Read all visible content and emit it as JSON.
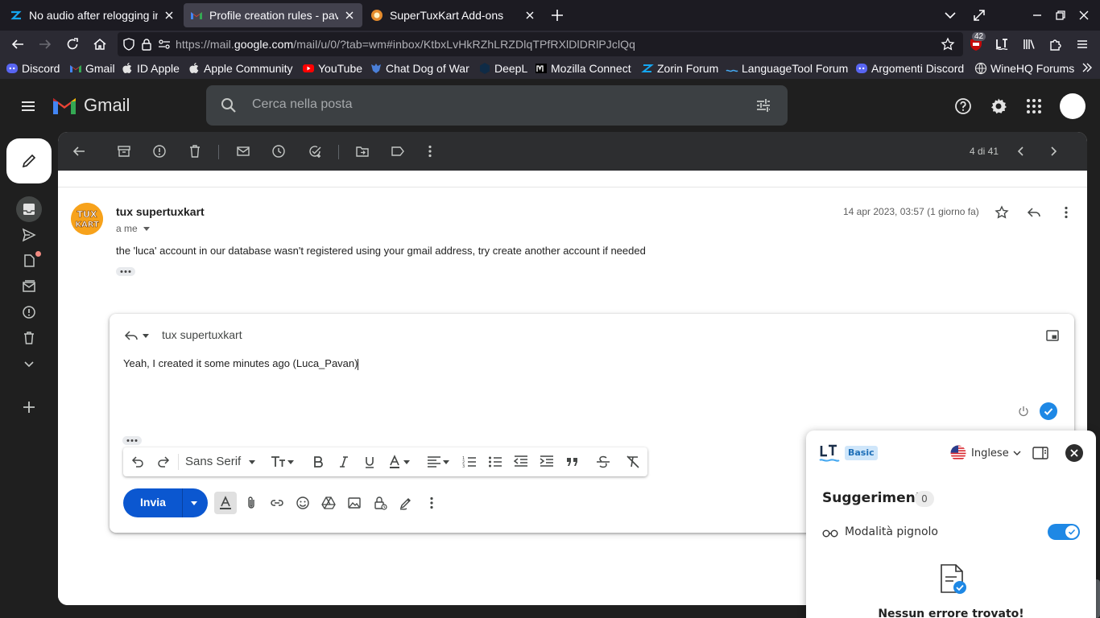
{
  "browser": {
    "tabs": [
      {
        "title": "No audio after relogging in",
        "active": false
      },
      {
        "title": "Profile creation rules - pav",
        "active": true
      },
      {
        "title": "SuperTuxKart Add-ons",
        "active": false
      }
    ],
    "url_prefix": "https://mail.",
    "url_domain": "google.com",
    "url_rest": "/mail/u/0/?tab=wm#inbox/KtbxLvHkRZhLRZDlqTPfRXlDlDRlPJclQq",
    "extension_badge": "42",
    "bookmarks": [
      "Discord",
      "Gmail",
      "ID Apple",
      "Apple Community",
      "YouTube",
      "Chat Dog of War",
      "DeepL",
      "Mozilla Connect",
      "Zorin Forum",
      "LanguageTool Forum",
      "Argomenti Discord",
      "WineHQ Forums"
    ]
  },
  "gmail": {
    "brand": "Gmail",
    "search_placeholder": "Cerca nella posta",
    "pager": "4 di 41",
    "message": {
      "sender": "tux supertuxkart",
      "to": "a me",
      "date": "14 apr 2023, 03:57 (1 giorno fa)",
      "body": "the 'luca' account in our database wasn't registered using your gmail address, try create another account if needed"
    },
    "reply": {
      "recipient": "tux supertuxkart",
      "text": "Yeah, I created it some minutes ago (Luca_Pavan)",
      "font": "Sans Serif",
      "send_label": "Invia"
    }
  },
  "languagetool": {
    "plan": "Basic",
    "language": "Inglese",
    "title": "Suggerimenti",
    "count": "0",
    "mode_label": "Modalità pignolo",
    "mode_on": true,
    "no_errors": "Nessun errore trovato!"
  },
  "colors": {
    "accent_blue": "#0b57d0",
    "gmail_red": "#ea4335",
    "lt_blue": "#1e88e5"
  }
}
